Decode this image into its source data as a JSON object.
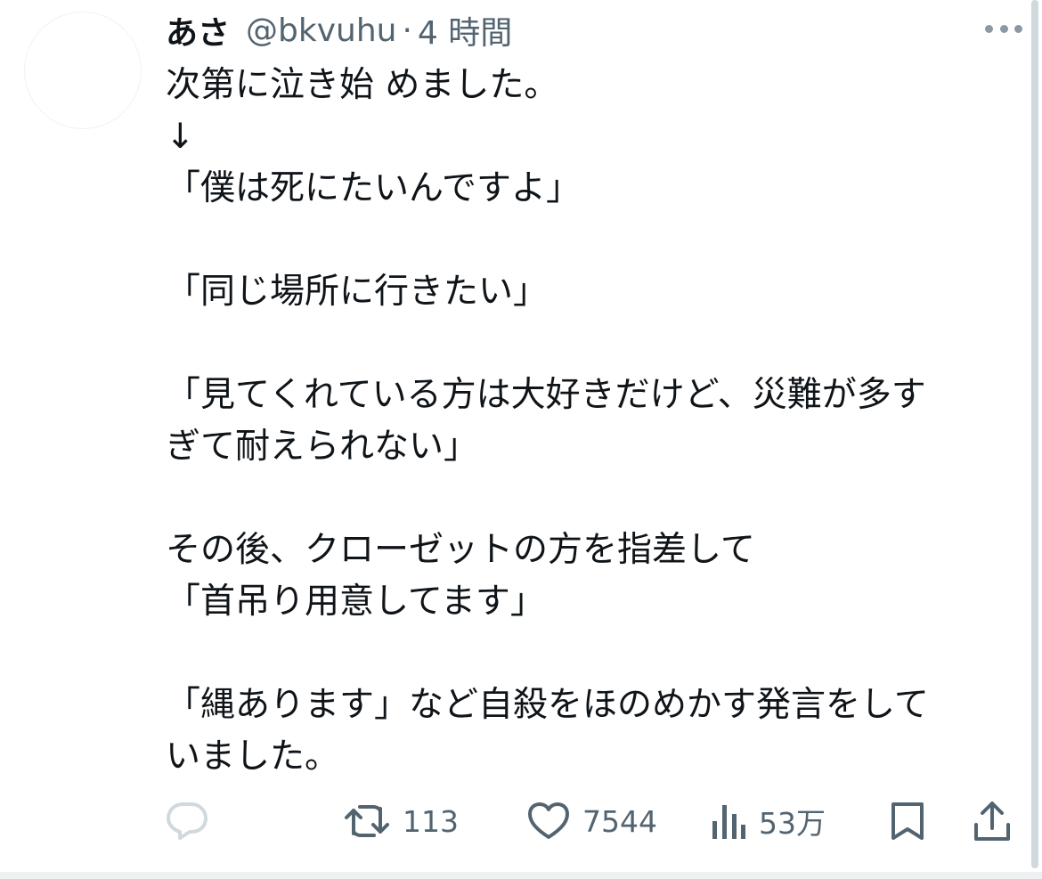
{
  "post": {
    "author": {
      "display_name": "あさ",
      "handle": "@bkvuhu"
    },
    "separator": "·",
    "timestamp": "4 時間",
    "text_lines": [
      "次第に泣き始 めました。",
      "↓",
      "「僕は死にたいんですよ」",
      "",
      "「同じ場所に行きたい」",
      "",
      "「見てくれている方は大好きだけど、災難が多す",
      "ぎて耐えられない」",
      "",
      "その後、クローゼットの方を指差して",
      "「首吊り用意してます」",
      "",
      "「縄あります」など自殺をほのめかす発言をして",
      "いました。"
    ]
  },
  "actions": {
    "reply": {
      "icon": "reply-icon",
      "count": ""
    },
    "retweet": {
      "icon": "retweet-icon",
      "count": "113"
    },
    "like": {
      "icon": "heart-icon",
      "count": "7544"
    },
    "views": {
      "icon": "views-icon",
      "count": "53万"
    },
    "bookmark": {
      "icon": "bookmark-icon"
    },
    "share": {
      "icon": "share-icon"
    }
  },
  "colors": {
    "text": "#0f1419",
    "secondary": "#536471",
    "reply_icon": "#cfd9de"
  }
}
